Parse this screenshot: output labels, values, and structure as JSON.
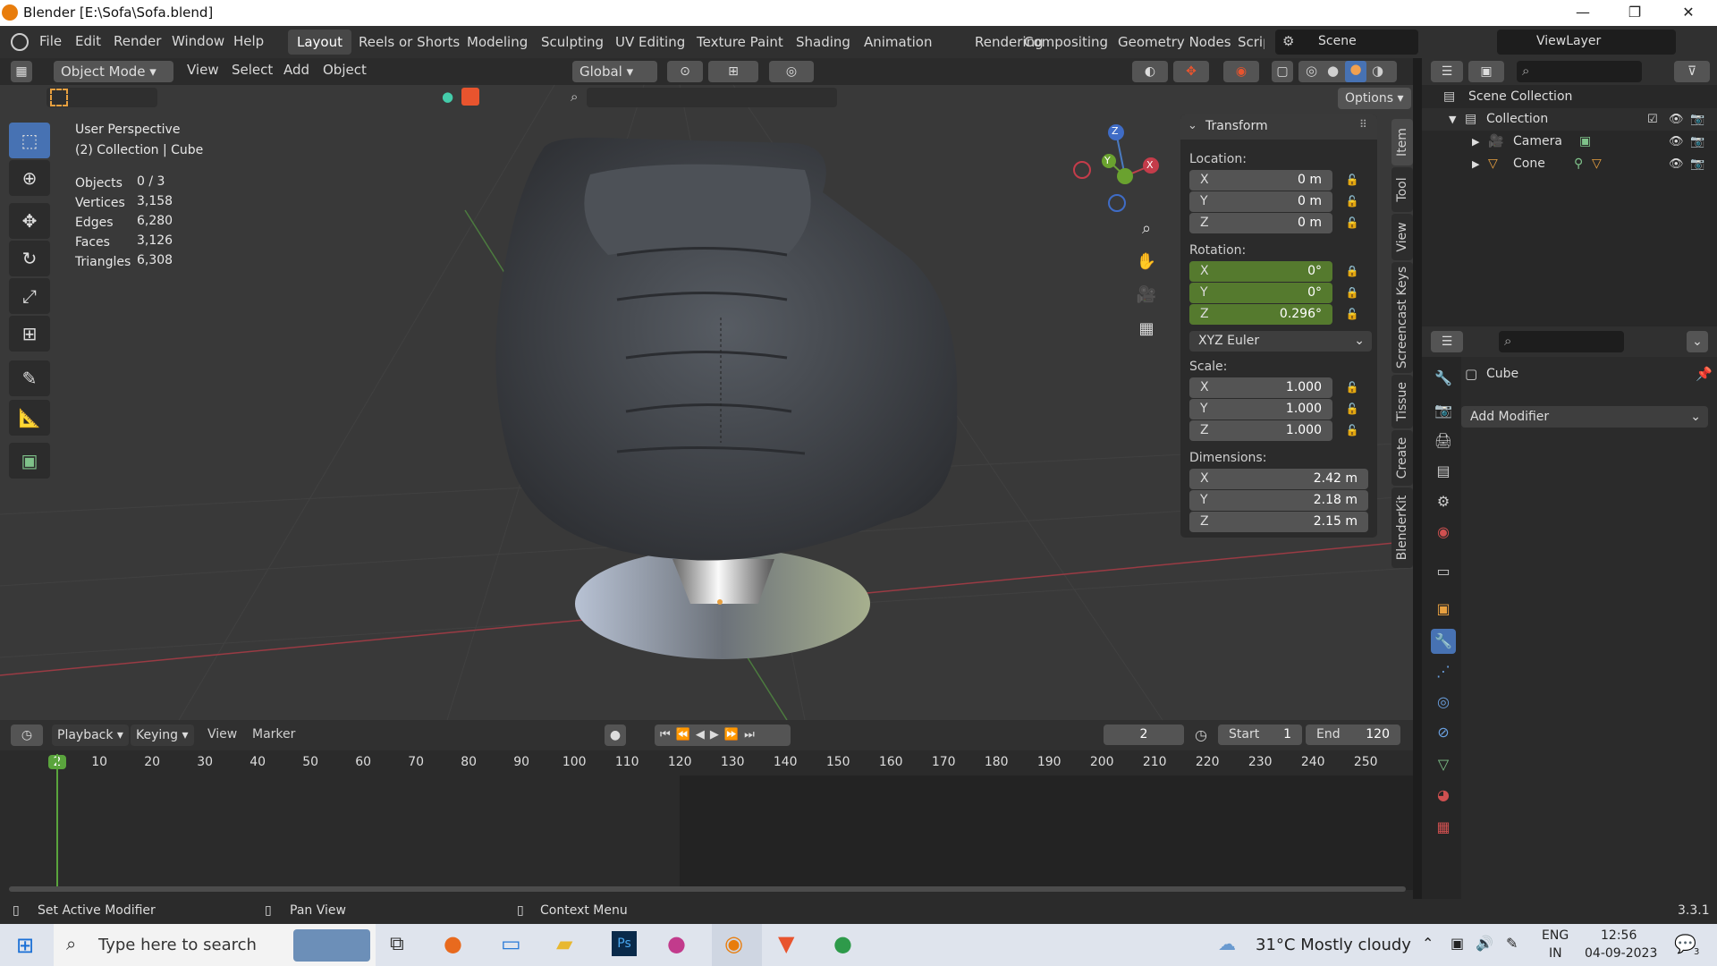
{
  "window": {
    "title": "Blender [E:\\Sofa\\Sofa.blend]",
    "min": "—",
    "max": "❐",
    "close": "✕"
  },
  "menus": [
    "File",
    "Edit",
    "Render",
    "Window",
    "Help"
  ],
  "workspaces": [
    "Layout",
    "Reels or Shorts",
    "Modeling",
    "Sculpting",
    "UV Editing",
    "Texture Paint",
    "Shading",
    "Animation",
    "Rendering",
    "Compositing",
    "Geometry Nodes",
    "Scrip"
  ],
  "scene": "Scene",
  "view_layer": "ViewLayer",
  "viewport_header": {
    "mode": "Object Mode",
    "view": "View",
    "select": "Select",
    "add": "Add",
    "object": "Object",
    "orientation": "Global",
    "options": "Options"
  },
  "viewport_info": {
    "perspective": "User Perspective",
    "collection": "(2) Collection | Cube"
  },
  "stats": [
    {
      "label": "Objects",
      "value": "0 / 3"
    },
    {
      "label": "Vertices",
      "value": "3,158"
    },
    {
      "label": "Edges",
      "value": "6,280"
    },
    {
      "label": "Faces",
      "value": "3,126"
    },
    {
      "label": "Triangles",
      "value": "6,308"
    }
  ],
  "gizmo": {
    "x": "X",
    "y": "Y",
    "z": "Z"
  },
  "transform": {
    "title": "Transform",
    "location_label": "Location:",
    "location": [
      {
        "axis": "X",
        "value": "0 m"
      },
      {
        "axis": "Y",
        "value": "0 m"
      },
      {
        "axis": "Z",
        "value": "0 m"
      }
    ],
    "rotation_label": "Rotation:",
    "rotation": [
      {
        "axis": "X",
        "value": "0°"
      },
      {
        "axis": "Y",
        "value": "0°"
      },
      {
        "axis": "Z",
        "value": "0.296°"
      }
    ],
    "rotation_mode": "XYZ Euler",
    "scale_label": "Scale:",
    "scale": [
      {
        "axis": "X",
        "value": "1.000"
      },
      {
        "axis": "Y",
        "value": "1.000"
      },
      {
        "axis": "Z",
        "value": "1.000"
      }
    ],
    "dimensions_label": "Dimensions:",
    "dimensions": [
      {
        "axis": "X",
        "value": "2.42 m"
      },
      {
        "axis": "Y",
        "value": "2.18 m"
      },
      {
        "axis": "Z",
        "value": "2.15 m"
      }
    ]
  },
  "side_tabs": [
    "Item",
    "Tool",
    "View",
    "Screencast Keys",
    "Tissue",
    "Create",
    "BlenderKit"
  ],
  "outliner": {
    "root": "Scene Collection",
    "collection": "Collection",
    "items": [
      "Camera",
      "Cone"
    ]
  },
  "properties": {
    "object": "Cube",
    "add_modifier": "Add Modifier"
  },
  "timeline": {
    "playback": "Playback",
    "keying": "Keying",
    "view": "View",
    "marker": "Marker",
    "current_frame": "2",
    "start_label": "Start",
    "start": "1",
    "end_label": "End",
    "end": "120",
    "ticks": [
      "2",
      "10",
      "20",
      "30",
      "40",
      "50",
      "60",
      "70",
      "80",
      "90",
      "100",
      "110",
      "120",
      "130",
      "140",
      "150",
      "160",
      "170",
      "180",
      "190",
      "200",
      "210",
      "220",
      "230",
      "240",
      "250"
    ]
  },
  "statusbar": {
    "left": "Set Active Modifier",
    "middle": "Pan View",
    "right": "Context Menu",
    "version": "3.3.1"
  },
  "taskbar": {
    "search": "Type here to search",
    "weather": "31°C  Mostly cloudy",
    "lang1": "ENG",
    "lang2": "IN",
    "time": "12:56",
    "date": "04-09-2023",
    "notif": "3"
  },
  "colors": {
    "accent": "#4772b3",
    "active_green": "#557a2e",
    "orange": "#e87d0d"
  }
}
